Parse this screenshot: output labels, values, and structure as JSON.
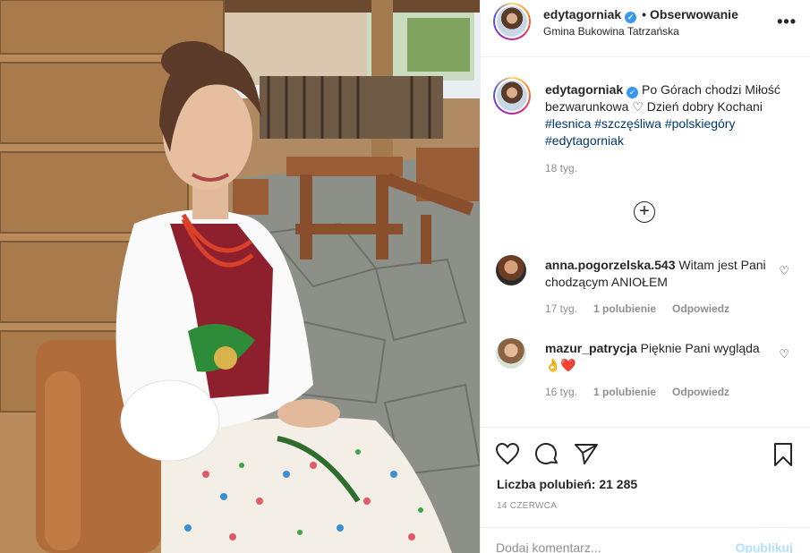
{
  "header": {
    "username": "edytagorniak",
    "separator": "•",
    "follow_label": "Obserwowanie",
    "location": "Gmina Bukowina Tatrzańska",
    "more_icon": "more-horizontal-icon"
  },
  "caption": {
    "username": "edytagorniak",
    "text_1": "Po Górach chodzi Miłość bezwarunkowa",
    "text_2": "Dzień dobry Kochani",
    "tags": [
      "#lesnica",
      "#szczęśliwa",
      "#polskiegóry",
      "#edytagorniak"
    ],
    "time": "18 tyg."
  },
  "load_more_icon": "plus-circle-icon",
  "comments": [
    {
      "username": "anna.pogorzelska.543",
      "text": "Witam jest Pani chodzącym ANIOŁEM",
      "time": "17 tyg.",
      "likes": "1 polubienie",
      "reply": "Odpowiedz"
    },
    {
      "username": "mazur_patrycja",
      "text": "Pięknie Pani wygląda 👌❤️",
      "time": "16 tyg.",
      "likes": "1 polubienie",
      "reply": "Odpowiedz"
    }
  ],
  "actions": {
    "icons": [
      "heart-icon",
      "comment-icon",
      "share-icon",
      "bookmark-icon"
    ],
    "likes_label": "Liczba polubień: 21 285",
    "date": "14 CZERWCA"
  },
  "add_comment": {
    "placeholder": "Dodaj komentarz...",
    "publish_label": "Opublikuj"
  },
  "colors": {
    "link": "#00376b",
    "verified": "#3897f0",
    "muted": "#8e8e8e",
    "publish_disabled": "#b2dffc"
  }
}
